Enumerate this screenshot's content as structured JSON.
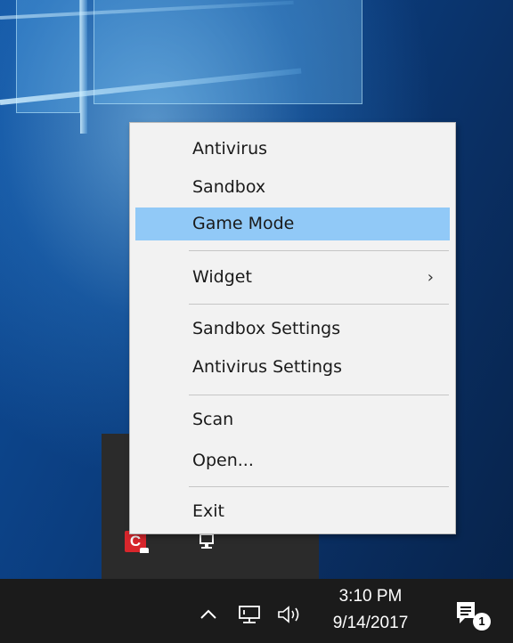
{
  "context_menu": {
    "items": [
      {
        "label": "Antivirus"
      },
      {
        "label": "Sandbox"
      },
      {
        "label": "Game Mode",
        "highlighted": true
      },
      {
        "label": "Widget",
        "submenu": true
      },
      {
        "label": "Sandbox Settings"
      },
      {
        "label": "Antivirus Settings"
      },
      {
        "label": "Scan"
      },
      {
        "label": "Open..."
      },
      {
        "label": "Exit"
      }
    ],
    "submenu_arrow": "›",
    "highlight_color": "#91c9f7"
  },
  "tray_flyout": {
    "icons": [
      "comodo-icon",
      "network-icon"
    ],
    "comodo_letter": "C",
    "brand_color": "#d8262c"
  },
  "taskbar": {
    "show_hidden_icons_glyph": "^",
    "clock_time": "3:10 PM",
    "clock_date": "9/14/2017",
    "notification_count": "1",
    "icons": [
      "chevron-up-icon",
      "network-icon",
      "volume-icon",
      "action-center-icon"
    ]
  }
}
